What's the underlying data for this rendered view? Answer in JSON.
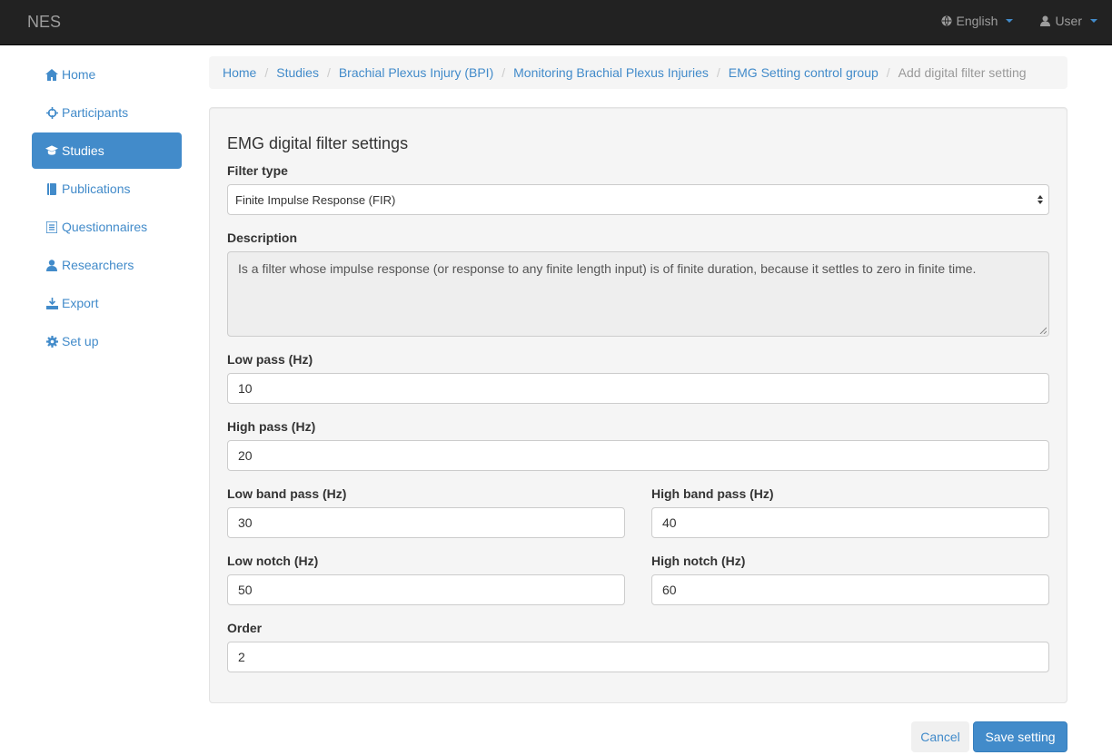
{
  "navbar": {
    "brand": "NES",
    "language": "English",
    "user": "User"
  },
  "sidebar": {
    "items": [
      {
        "label": "Home",
        "icon": "home-icon"
      },
      {
        "label": "Participants",
        "icon": "crosshair-icon"
      },
      {
        "label": "Studies",
        "icon": "graduation-cap-icon",
        "active": true
      },
      {
        "label": "Publications",
        "icon": "book-icon"
      },
      {
        "label": "Questionnaires",
        "icon": "list-icon"
      },
      {
        "label": "Researchers",
        "icon": "user-icon"
      },
      {
        "label": "Export",
        "icon": "export-icon"
      },
      {
        "label": "Set up",
        "icon": "gear-icon"
      }
    ]
  },
  "breadcrumb": [
    "Home",
    "Studies",
    "Brachial Plexus Injury (BPI)",
    "Monitoring Brachial Plexus Injuries",
    "EMG Setting control group",
    "Add digital filter setting"
  ],
  "form": {
    "title": "EMG digital filter settings",
    "filter_type_label": "Filter type",
    "filter_type_value": "Finite Impulse Response (FIR)",
    "description_label": "Description",
    "description_value": "Is a filter whose impulse response (or response to any finite length input) is of finite duration, because it settles to zero in finite time.",
    "low_pass_label": "Low pass (Hz)",
    "low_pass_value": "10",
    "high_pass_label": "High pass (Hz)",
    "high_pass_value": "20",
    "low_band_pass_label": "Low band pass (Hz)",
    "low_band_pass_value": "30",
    "high_band_pass_label": "High band pass (Hz)",
    "high_band_pass_value": "40",
    "low_notch_label": "Low notch (Hz)",
    "low_notch_value": "50",
    "high_notch_label": "High notch (Hz)",
    "high_notch_value": "60",
    "order_label": "Order",
    "order_value": "2"
  },
  "buttons": {
    "cancel": "Cancel",
    "save": "Save setting"
  },
  "colors": {
    "accent": "#428bca",
    "navbar": "#222222"
  }
}
